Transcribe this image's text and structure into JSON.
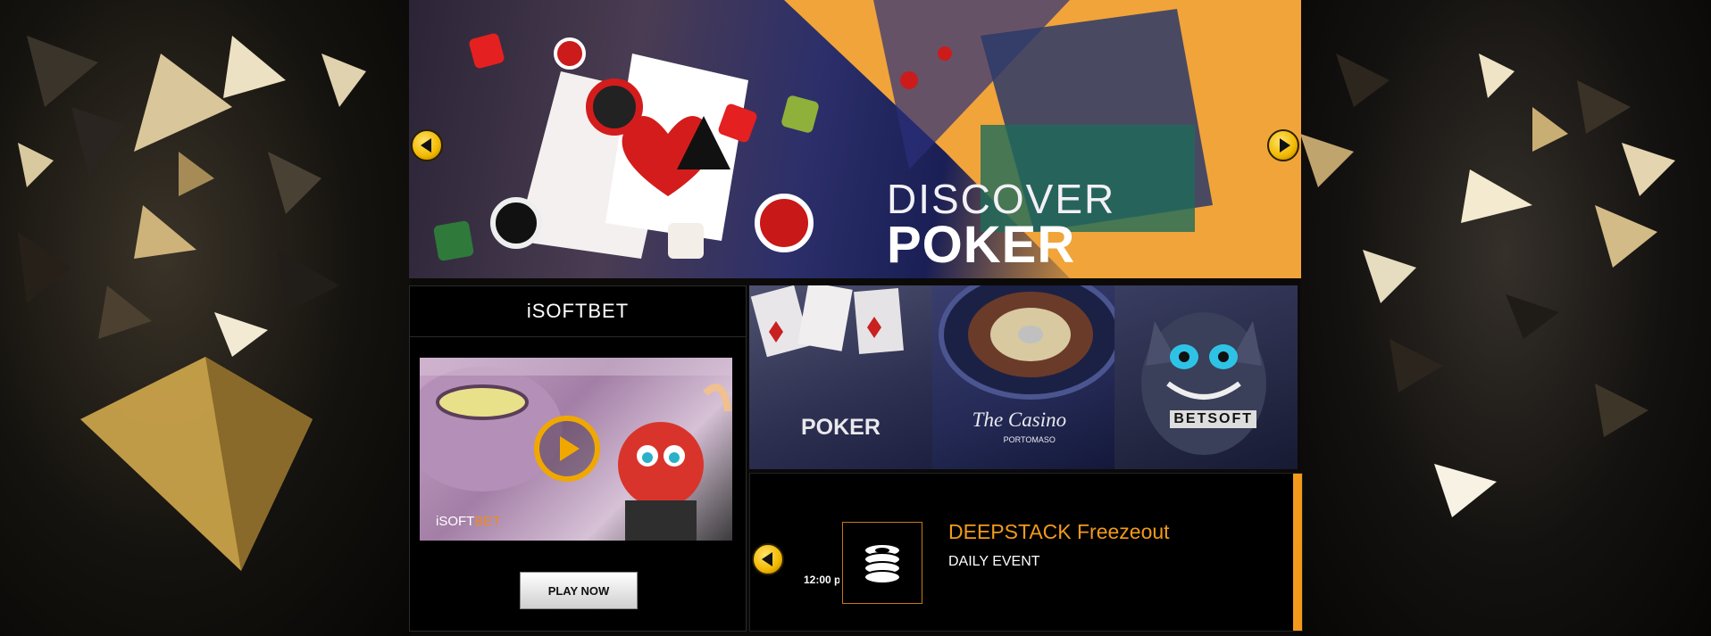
{
  "hero": {
    "title_line1": "DISCOVER",
    "title_line2": "POKER",
    "prev_icon": "chevron-left-icon",
    "next_icon": "chevron-right-icon"
  },
  "promo": {
    "brand": "iSOFTBET",
    "video_brand_prefix": "iSOFT",
    "video_brand_suffix": "BET",
    "play_icon": "play-icon",
    "button_label": "PLAY NOW"
  },
  "tiles": [
    {
      "label": "POKER"
    },
    {
      "label": "The Casino",
      "sublabel": "PORTOMASO"
    },
    {
      "label": "BETSOFT"
    }
  ],
  "event": {
    "time": "12:00 p",
    "title": "DEEPSTACK Freezeout",
    "subtitle": "DAILY EVENT",
    "icon": "poker-chips-icon"
  },
  "colors": {
    "accent": "#f29a1c",
    "arrow": "#f2b800"
  }
}
